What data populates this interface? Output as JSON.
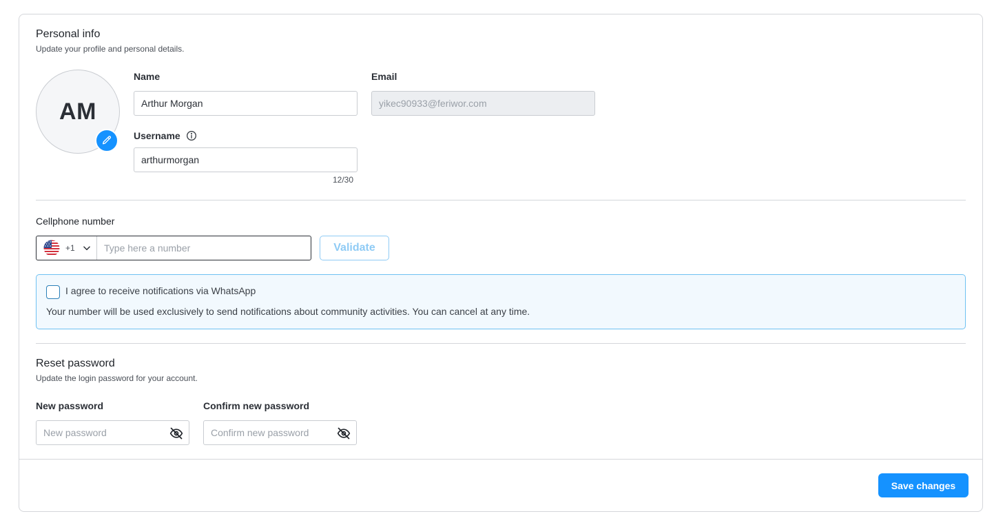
{
  "personal": {
    "title": "Personal info",
    "subtitle": "Update your profile and personal details.",
    "avatar_initials": "AM",
    "name_label": "Name",
    "name_value": "Arthur Morgan",
    "email_label": "Email",
    "email_value": "yikec90933@feriwor.com",
    "username_label": "Username",
    "username_value": "arthurmorgan",
    "username_counter": "12/30"
  },
  "phone": {
    "label": "Cellphone number",
    "country_code": "+1",
    "placeholder": "Type here a number",
    "validate_label": "Validate",
    "whatsapp_label": "I agree to receive notifications via WhatsApp",
    "whatsapp_note": "Your number will be used exclusively to send notifications about community activities. You can cancel at any time."
  },
  "password": {
    "title": "Reset password",
    "subtitle": "Update the login password for your account.",
    "new_label": "New password",
    "new_placeholder": "New password",
    "confirm_label": "Confirm new password",
    "confirm_placeholder": "Confirm new password"
  },
  "footer": {
    "save_label": "Save changes"
  },
  "colors": {
    "accent": "#1592ff",
    "notice_border": "#6ec1f2",
    "notice_bg": "#f2f9fe"
  }
}
